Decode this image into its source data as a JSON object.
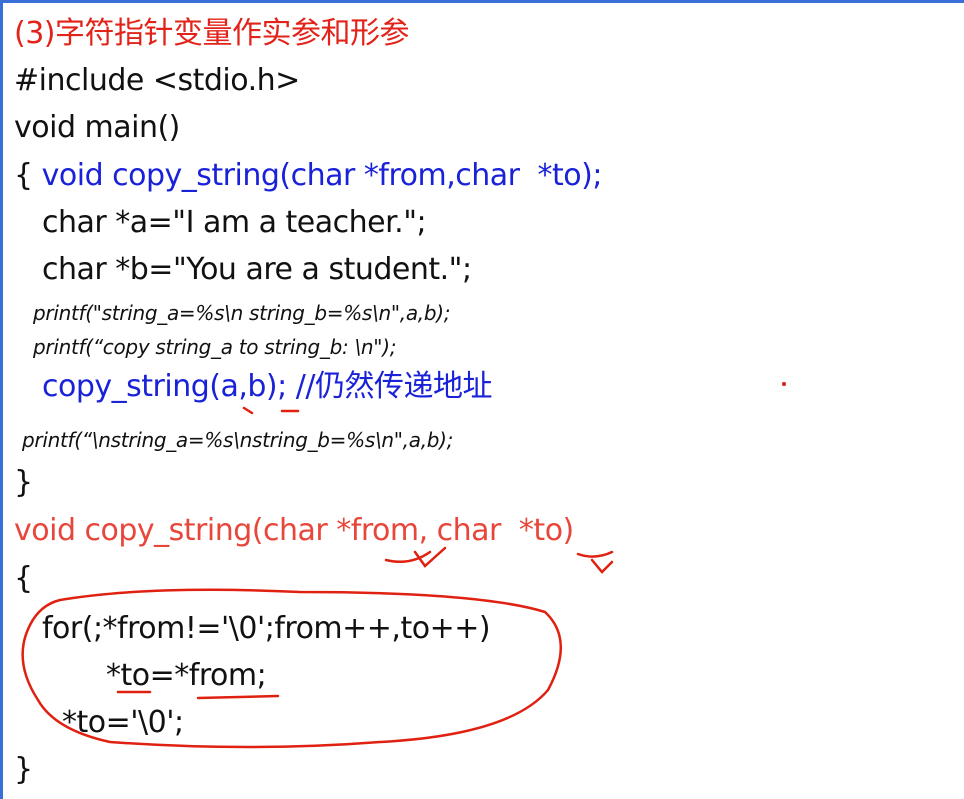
{
  "title": "(3)字符指针变量作实参和形参",
  "code": {
    "l1": "#include <stdio.h>",
    "l2": "void main()",
    "l3_brace": "{ ",
    "l3_decl": "void copy_string(char *from,char  *to);",
    "l4": "char *a=\"I am a teacher.\";",
    "l5": "char *b=\"You are a student.\";",
    "l6": "printf(\"string_a=%s\\n string_b=%s\\n\",a,b);",
    "l7": "printf(“copy string_a to string_b: \\n\");",
    "l8": "copy_string(a,b); //仍然传递地址",
    "l9": "printf(“\\nstring_a=%s\\nstring_b=%s\\n\",a,b);",
    "l10": "}",
    "l11": "void copy_string(char *from, char  *to)",
    "l12": "{",
    "l13": "for(;*from!='\\0';from++,to++)",
    "l14": "*to=*from;",
    "l15": "*to='\\0';",
    "l16": "}"
  },
  "colors": {
    "title": "#e2231a",
    "blue": "#1a22d8",
    "function_def": "#e8463a",
    "annotation": "#e02010",
    "border": "#3b6fd8"
  }
}
